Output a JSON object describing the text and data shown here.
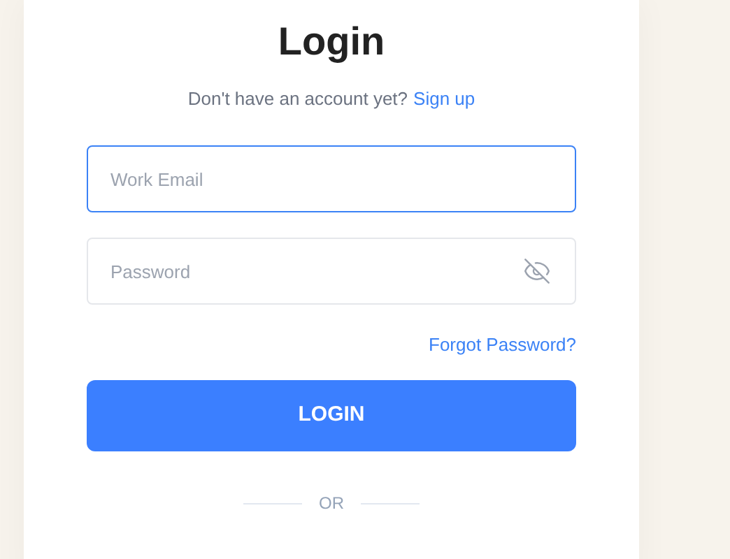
{
  "title": "Login",
  "signup_prompt": {
    "text": "Don't have an account yet?",
    "link": "Sign up"
  },
  "fields": [
    {
      "placeholder": "Work Email",
      "focused": true,
      "kind": "text"
    },
    {
      "placeholder": "Password",
      "focused": false,
      "kind": "password"
    }
  ],
  "forgot_link": "Forgot Password?",
  "login_button": "LOGIN",
  "divider_label": "OR"
}
